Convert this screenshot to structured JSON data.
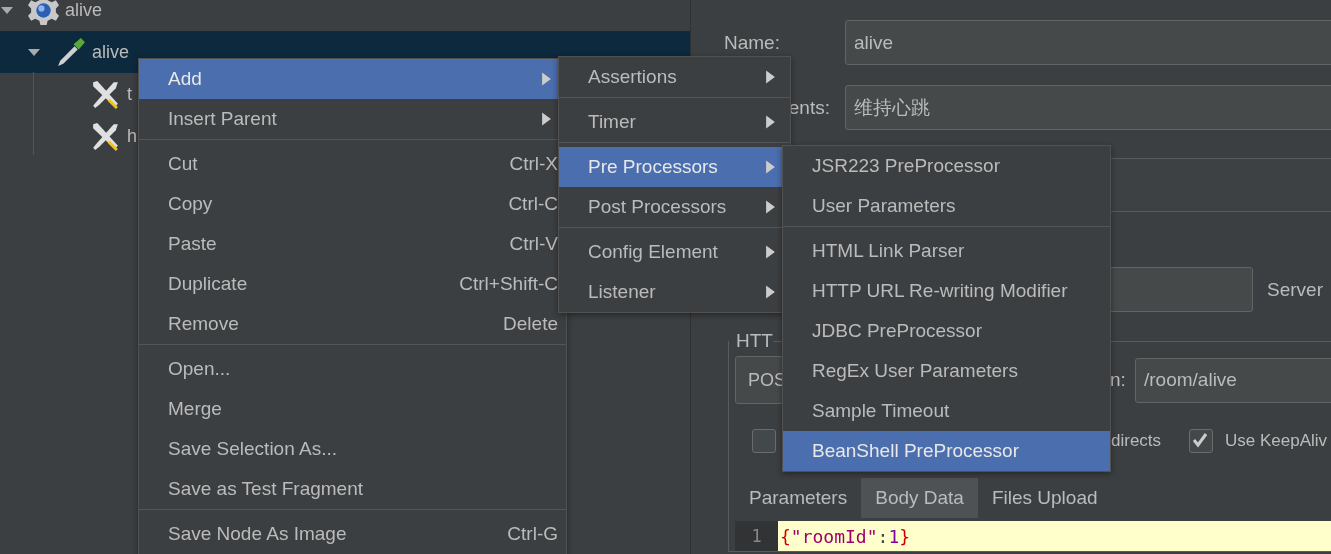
{
  "tree": [
    {
      "label": "alive",
      "kind": "plan",
      "expanded": true,
      "selected": false,
      "children": [
        {
          "label": "alive",
          "kind": "sampler",
          "expanded": true,
          "selected": true,
          "children": [
            {
              "label": "t",
              "kind": "config",
              "selected": false
            },
            {
              "label": "h",
              "kind": "config",
              "selected": false
            }
          ]
        }
      ]
    }
  ],
  "form": {
    "name_label": "Name:",
    "name_value": "alive",
    "comments_label": "ents:",
    "comments_value": "维持心跳",
    "server_label": "Server",
    "http_label": "HTT",
    "method": "POS",
    "path_label": "n:",
    "path_value": "/room/alive",
    "first_checkbox": {
      "checked": false
    },
    "redirects_label": "directs",
    "keepalive": {
      "label": "Use KeepAliv",
      "checked": true
    }
  },
  "tabs": [
    {
      "label": "Parameters",
      "selected": false
    },
    {
      "label": "Body Data",
      "selected": true
    },
    {
      "label": "Files Upload",
      "selected": false
    }
  ],
  "editor": {
    "line_number": "1",
    "tokens": [
      {
        "text": "{",
        "kind": "brace"
      },
      {
        "text": "\"roomId\"",
        "kind": "string"
      },
      {
        "text": ":",
        "kind": "punct"
      },
      {
        "text": "1",
        "kind": "number"
      },
      {
        "text": "}",
        "kind": "brace"
      }
    ]
  },
  "menus": [
    {
      "groups": [
        [
          {
            "label": "Add",
            "submenu": true,
            "selected": true
          },
          {
            "label": "Insert Parent",
            "submenu": true,
            "selected": false
          }
        ],
        [
          {
            "label": "Cut",
            "shortcut": "Ctrl-X",
            "selected": false
          },
          {
            "label": "Copy",
            "shortcut": "Ctrl-C",
            "selected": false
          },
          {
            "label": "Paste",
            "shortcut": "Ctrl-V",
            "selected": false
          },
          {
            "label": "Duplicate",
            "shortcut": "Ctrl+Shift-C",
            "selected": false
          },
          {
            "label": "Remove",
            "shortcut": "Delete",
            "selected": false
          }
        ],
        [
          {
            "label": "Open...",
            "selected": false
          },
          {
            "label": "Merge",
            "selected": false
          },
          {
            "label": "Save Selection As...",
            "selected": false
          },
          {
            "label": "Save as Test Fragment",
            "selected": false
          }
        ],
        [
          {
            "label": "Save Node As Image",
            "shortcut": "Ctrl-G",
            "selected": false
          }
        ]
      ]
    },
    {
      "groups": [
        [
          {
            "label": "Assertions",
            "submenu": true,
            "selected": false
          }
        ],
        [
          {
            "label": "Timer",
            "submenu": true,
            "selected": false
          }
        ],
        [
          {
            "label": "Pre Processors",
            "submenu": true,
            "selected": true
          },
          {
            "label": "Post Processors",
            "submenu": true,
            "selected": false
          }
        ],
        [
          {
            "label": "Config Element",
            "submenu": true,
            "selected": false
          },
          {
            "label": "Listener",
            "submenu": true,
            "selected": false
          }
        ]
      ]
    },
    {
      "groups": [
        [
          {
            "label": "JSR223 PreProcessor",
            "selected": false
          },
          {
            "label": "User Parameters",
            "selected": false
          }
        ],
        [
          {
            "label": "HTML Link Parser",
            "selected": false
          },
          {
            "label": "HTTP URL Re-writing Modifier",
            "selected": false
          },
          {
            "label": "JDBC PreProcessor",
            "selected": false
          },
          {
            "label": "RegEx User Parameters",
            "selected": false
          },
          {
            "label": "Sample Timeout",
            "selected": false
          },
          {
            "label": "BeanShell PreProcessor",
            "selected": true
          }
        ]
      ]
    }
  ]
}
